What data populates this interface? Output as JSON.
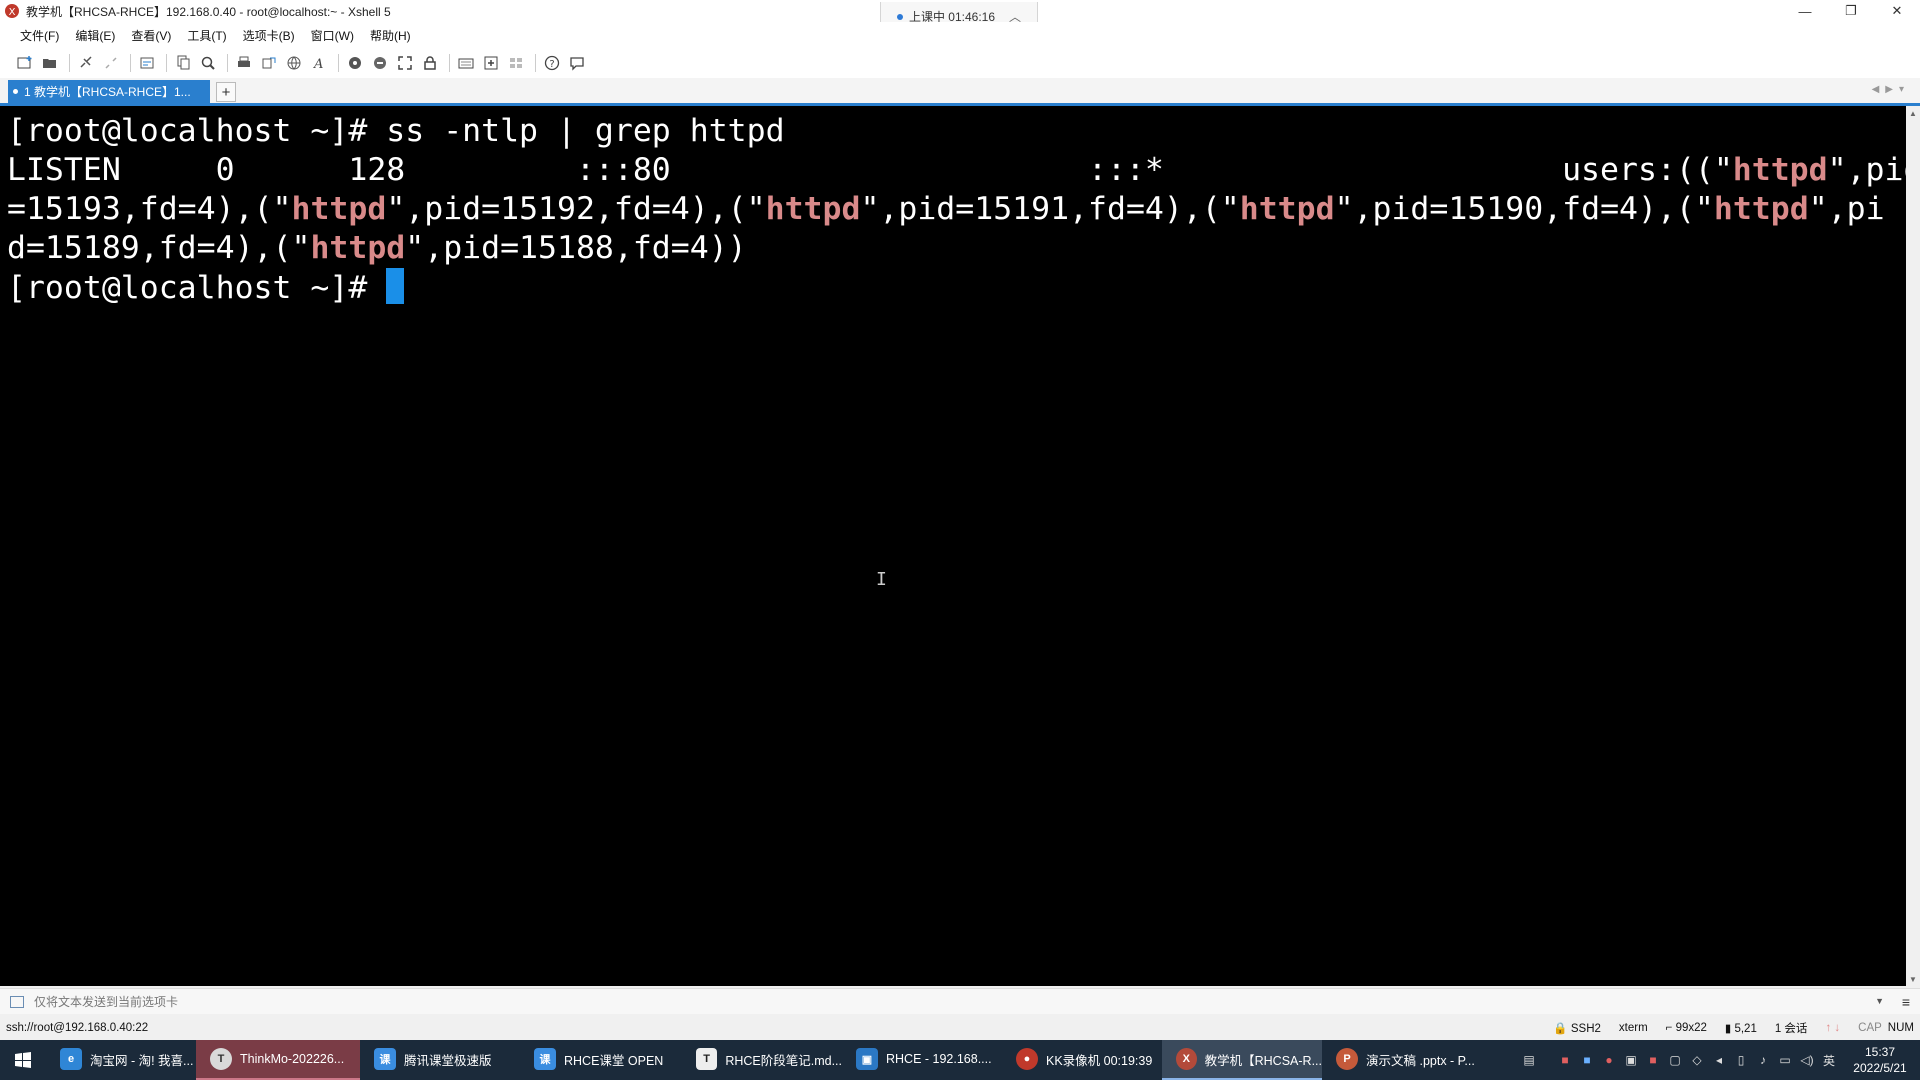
{
  "window": {
    "title": "教学机【RHCSA-RHCE】192.168.0.40 - root@localhost:~ - Xshell 5",
    "controls": [
      "—",
      "❐",
      "✕"
    ]
  },
  "class_status": {
    "label": "上课中 01:46:16"
  },
  "menu": [
    "文件(F)",
    "编辑(E)",
    "查看(V)",
    "工具(T)",
    "选项卡(B)",
    "窗口(W)",
    "帮助(H)"
  ],
  "tab": {
    "label": "1 教学机【RHCSA-RHCE】1...",
    "add_label": "+"
  },
  "terminal": {
    "prompt": "[root@localhost ~]# ",
    "command": "ss -ntlp | grep httpd",
    "line2_pre": "LISTEN     0      128         :::80                      :::*                     users:((\"",
    "line2_post": "\",pid",
    "line3_a": "=15193,fd=4),(\"",
    "line3_b": "\",pid=15192,fd=4),(\"",
    "line3_c": "\",pid=15191,fd=4),(\"",
    "line3_d": "\",pid=15190,fd=4),(\"",
    "line3_e": "\",pi",
    "line4_a": "d=15189,fd=4),(\"",
    "line4_b": "\",pid=15188,fd=4))",
    "highlight_word": "httpd",
    "highlight_color": "#d98a8a",
    "cursor_color": "#1a8fe8"
  },
  "sendbar": {
    "placeholder": "仅将文本发送到当前选项卡"
  },
  "status": {
    "connection": "ssh://root@192.168.0.40:22",
    "protocol": "SSH2",
    "term": "xterm",
    "size": "99x22",
    "pos": "5,21",
    "sessions": "1 会话",
    "cap": "CAP",
    "num": "NUM"
  },
  "taskbar": {
    "items": [
      {
        "label": "淘宝网 - 淘! 我喜...",
        "icon": "edge-icon",
        "color": "#2f86d6",
        "glyph": "e"
      },
      {
        "label": "ThinkMo-202226...",
        "icon": "thinkmo-icon",
        "color": "#d9d9d9",
        "glyph": "T"
      },
      {
        "label": "腾讯课堂极速版",
        "icon": "tencent-class-icon",
        "color": "#3a8de0",
        "glyph": "课"
      },
      {
        "label": "RHCE课堂 OPEN",
        "icon": "class-open-icon",
        "color": "#3a8de0",
        "glyph": "课"
      },
      {
        "label": "RHCE阶段笔记.md...",
        "icon": "typora-icon",
        "color": "#eeeeee",
        "glyph": "T"
      },
      {
        "label": "RHCE - 192.168....",
        "icon": "remote-desktop-icon",
        "color": "#2b78c4",
        "glyph": "▣"
      },
      {
        "label": "KK录像机 00:19:39",
        "icon": "kk-recorder-icon",
        "color": "#c0392b",
        "glyph": "●"
      },
      {
        "label": "教学机【RHCSA-R...",
        "icon": "xshell-icon",
        "color": "#b34a3a",
        "glyph": "X"
      },
      {
        "label": "演示文稿 .pptx - P...",
        "icon": "powerpoint-icon",
        "color": "#c55a3a",
        "glyph": "P"
      }
    ],
    "input_method": "英",
    "time": "15:37",
    "date": "2022/5/21"
  }
}
